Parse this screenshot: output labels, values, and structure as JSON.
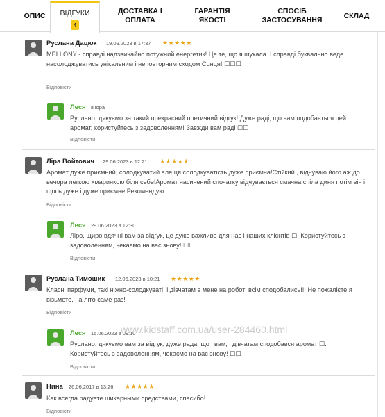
{
  "tabs": [
    {
      "label": "ОПИС"
    },
    {
      "label": "ВІДГУКИ",
      "badge": "4"
    },
    {
      "label": "ДОСТАВКА І ОПЛАТА"
    },
    {
      "label": "ГАРАНТІЯ ЯКОСТІ"
    },
    {
      "label": "СПОСІБ ЗАСТОСУВАННЯ"
    },
    {
      "label": "СКЛАД"
    }
  ],
  "reply_label": "Відповісти",
  "star_color": "#e8a517",
  "reply_color": "#4aa82c",
  "reviews": [
    {
      "author": "Руслана Дацюк",
      "date": "19.09.2023 в 17:37",
      "stars": "★★★★★",
      "text": "MELLONY - справді надзвичайно потужний енергетик! Це те, що я шукала. І справді буквально веде насолоджуватись унікальним і неповторним сходом Сонця! ☐☐☐",
      "reply": {
        "author": "Леся",
        "date": "вчора",
        "text": "Руслано, дякуємо за такий прекрасний поетичний відгук! Дуже раді, що вам подобається цей аромат, користуйтесь з задоволенням! Завжди вам раді ☐☐"
      }
    },
    {
      "author": "Ліра Войтович",
      "date": "29.06.2023 в 12:21",
      "stars": "★★★★★",
      "text": "Аромат дуже приємний, солодкуватий але ця солодкуватість дуже приємна!Стійкий , відчуваю його аж до вечора легкою хмаринкою біля себе!Аромат насичений спочатку відчувається смачна спіла диня потім він і щось дуже і дуже приємне.Рекомендую",
      "reply": {
        "author": "Леся",
        "date": "29.06.2023 в 12:30",
        "text": "Ліро, щиро вдячні вам за відгук, це дуже важливо для нас і наших клієнтів ☐. Користуйтесь з задоволенням, чекаємо на вас знову! ☐☐"
      }
    },
    {
      "author": "Руслана Тимошик",
      "date": "12.06.2023 в 10:21",
      "stars": "★★★★★",
      "text": "Класні парфуми, такі ніжно-солодкуваті, і дівчатам в мене на роботі всім сподобались!!! Не пожалієте я візьмете, на літо саме раз!",
      "reply": {
        "author": "Леся",
        "date": "15.06.2023 в 09:10",
        "text": "Руслано, дякуємо вам за відгук, дуже рада, що і вам, і дівчатам сподобався аромат ☐. Користуйтесь з задоволенням, чекаємо на вас знову! ☐☐"
      }
    },
    {
      "author": "Нина",
      "date": "26.06.2017 в 13:26",
      "stars": "★★★★★",
      "text": "Как всегда радуете шикарными средствами, спасибо!"
    }
  ],
  "watermark": "www.kidstaff.com.ua/user-284460.html"
}
